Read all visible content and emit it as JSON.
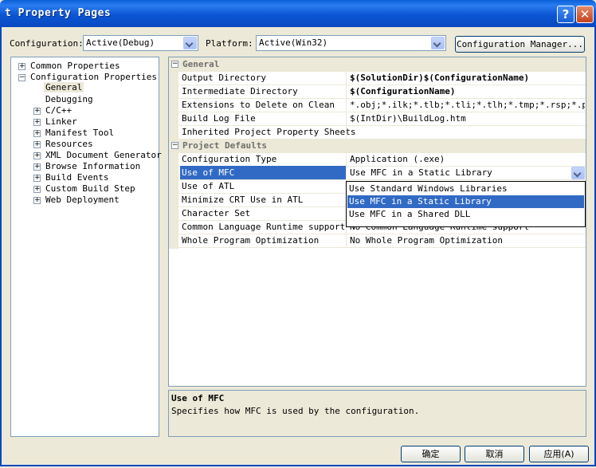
{
  "window": {
    "title": "t Property Pages",
    "help_icon": "?",
    "close_icon": "✕"
  },
  "toolbar": {
    "configuration_label": "Configuration:",
    "configuration_value": "Active(Debug)",
    "platform_label": "Platform:",
    "platform_value": "Active(Win32)",
    "config_manager_label": "Configuration Manager..."
  },
  "tree": {
    "items": [
      {
        "label": "Common Properties"
      },
      {
        "label": "Configuration Properties"
      },
      {
        "label": "General"
      },
      {
        "label": "Debugging"
      },
      {
        "label": "C/C++"
      },
      {
        "label": "Linker"
      },
      {
        "label": "Manifest Tool"
      },
      {
        "label": "Resources"
      },
      {
        "label": "XML Document Generator"
      },
      {
        "label": "Browse Information"
      },
      {
        "label": "Build Events"
      },
      {
        "label": "Custom Build Step"
      },
      {
        "label": "Web Deployment"
      }
    ]
  },
  "grid": {
    "general_header": "General",
    "general_rows": [
      {
        "name": "Output Directory",
        "value": "$(SolutionDir)$(ConfigurationName)"
      },
      {
        "name": "Intermediate Directory",
        "value": "$(ConfigurationName)"
      },
      {
        "name": "Extensions to Delete on Clean",
        "value": "*.obj;*.ilk;*.tlb;*.tli;*.tlh;*.tmp;*.rsp;*.pgc;*"
      },
      {
        "name": "Build Log File",
        "value": "$(IntDir)\\BuildLog.htm"
      },
      {
        "name": "Inherited Project Property Sheets",
        "value": ""
      }
    ],
    "defaults_header": "Project Defaults",
    "defaults_rows": [
      {
        "name": "Configuration Type",
        "value": "Application (.exe)"
      },
      {
        "name": "Use of MFC",
        "value": "Use MFC in a Static Library"
      },
      {
        "name": "Use of ATL",
        "value": ""
      },
      {
        "name": "Minimize CRT Use in ATL",
        "value": ""
      },
      {
        "name": "Character Set",
        "value": ""
      },
      {
        "name": "Common Language Runtime support",
        "value": "No Common Language Runtime support"
      },
      {
        "name": "Whole Program Optimization",
        "value": "No Whole Program Optimization"
      }
    ]
  },
  "dropdown": {
    "options": [
      "Use Standard Windows Libraries",
      "Use MFC in a Static Library",
      "Use MFC in a Shared DLL"
    ],
    "selected_index": 1
  },
  "description": {
    "title": "Use of MFC",
    "text": "Specifies how MFC is used by the configuration."
  },
  "buttons": {
    "ok": "确定",
    "cancel": "取消",
    "apply": "应用(A)"
  },
  "colors": {
    "selection": "#316ac5",
    "titlebar": "#0a5fd8"
  }
}
